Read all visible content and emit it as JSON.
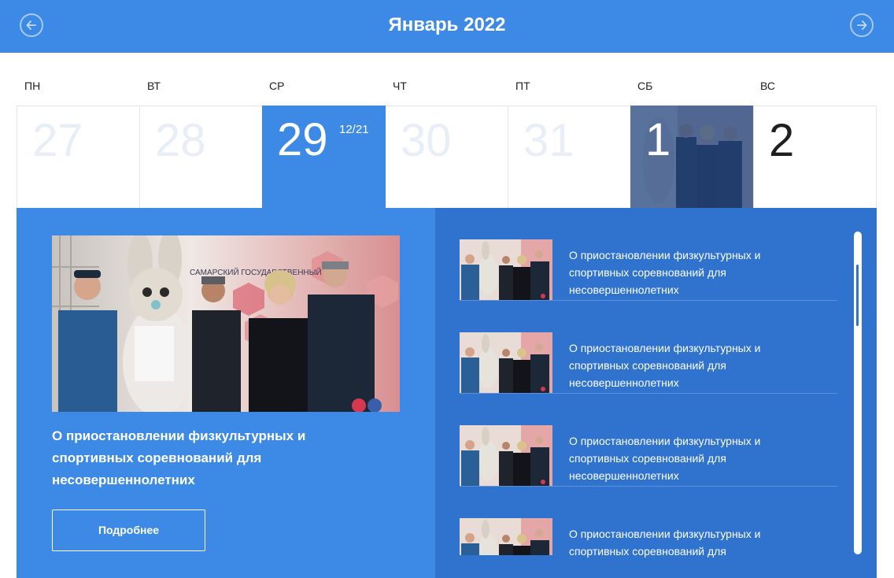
{
  "header": {
    "title": "Январь 2022"
  },
  "weekdays": [
    "ПН",
    "ВТ",
    "СР",
    "ЧТ",
    "ПТ",
    "СБ",
    "ВС"
  ],
  "days": [
    {
      "num": "27"
    },
    {
      "num": "28"
    },
    {
      "num": "29",
      "sub": "12/21"
    },
    {
      "num": "30"
    },
    {
      "num": "31"
    },
    {
      "num": "1"
    },
    {
      "num": "2"
    }
  ],
  "featured": {
    "headline": "О приостановлении физкультурных и спортивных соревнований для несовершеннолетних",
    "button_label": "Подробнее"
  },
  "news": [
    {
      "title": "О приостановлении физкультурных и спортивных соревнований для несовершеннолетних"
    },
    {
      "title": "О приостановлении физкультурных и спортивных соревнований для несовершеннолетних"
    },
    {
      "title": "О приостановлении физкультурных и спортивных соревнований для несовершеннолетних"
    },
    {
      "title": "О приостановлении физкультурных и спортивных соревнований для несовершеннолетних"
    }
  ],
  "colors": {
    "accent": "#3d8ae6",
    "panel_dark": "#2f73cf"
  }
}
